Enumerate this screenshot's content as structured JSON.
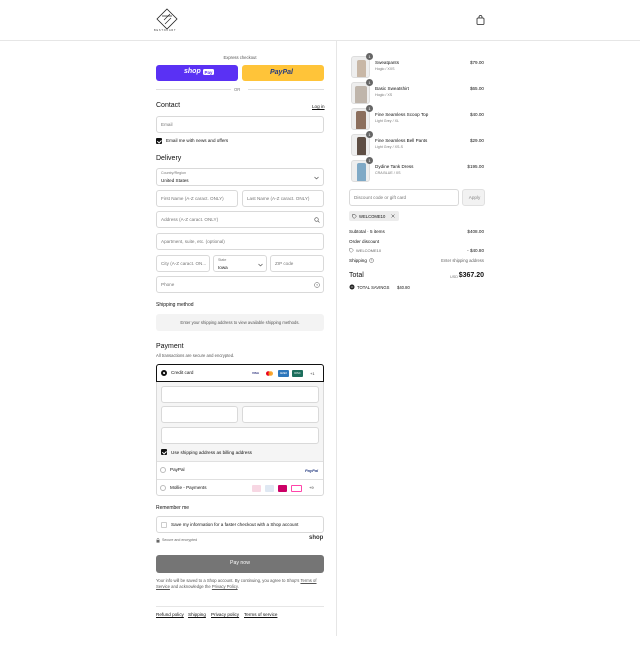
{
  "header": {
    "logo_text": "BESTNCART",
    "cart_icon": "shopping-bag-icon"
  },
  "express": {
    "title": "Express checkout",
    "shop_pay_label": "shop",
    "shop_pay_badge": "Pay",
    "paypal_label": "PayPal",
    "or_text": "OR"
  },
  "contact": {
    "title": "Contact",
    "login_link": "Log in",
    "email_placeholder": "Email",
    "news_label": "Email me with news and offers"
  },
  "delivery": {
    "title": "Delivery",
    "country_label": "Country/Region",
    "country_value": "United States",
    "first_name_placeholder": "First Name (A-Z caract. ONLY)",
    "last_name_placeholder": "Last Name (A-Z caract. ONLY)",
    "address_placeholder": "Address (A-Z caract. ONLY)",
    "apartment_placeholder": "Apartment, suite, etc. (optional)",
    "city_placeholder": "City (A-Z caract. ON...",
    "state_label": "State",
    "state_value": "Iowa",
    "zip_placeholder": "ZIP code",
    "phone_placeholder": "Phone"
  },
  "shipping_method": {
    "title": "Shipping method",
    "notice": "Enter your shipping address to view available shipping methods."
  },
  "payment": {
    "title": "Payment",
    "subtitle": "All transactions are secure and encrypted.",
    "credit_card_label": "Credit card",
    "card_logos": [
      "VISA",
      "MC",
      "AMEX",
      "DISC"
    ],
    "more_cards": "+1",
    "billing_label": "Use shipping address as billing address",
    "paypal_label": "PayPal",
    "paypal_logo": "PayPal",
    "mollie_label": "Mollie - Payments",
    "mollie_more": "+9"
  },
  "remember": {
    "title": "Remember me",
    "save_label": "Save my information for a faster checkout with a Shop account",
    "secure_text": "Secure and encrypted",
    "shop_logo": "shop"
  },
  "pay_button": "Pay now",
  "legal": {
    "line1": "Your info will be saved to a Shop account. By continuing, you agree to Shop's",
    "terms_link": "Terms of Service",
    "mid": " and acknowledge the ",
    "privacy_link": "Privacy Policy",
    "end": "."
  },
  "footer_links": [
    "Refund policy",
    "Shipping",
    "Privacy policy",
    "Terms of service"
  ],
  "cart": {
    "items": [
      {
        "name": "Sweatpants",
        "variant": "Hoglo / XXS",
        "price": "$79.00",
        "qty": "1",
        "color": "#c8b7a6"
      },
      {
        "name": "Basic Sweatshirt",
        "variant": "Hoglo / XS",
        "price": "$65.00",
        "qty": "1",
        "color": "#bfb5ab"
      },
      {
        "name": "Fine Seamless Scoop Top",
        "variant": "Light Grey / XL",
        "price": "$40.00",
        "qty": "1",
        "color": "#8c6f5d"
      },
      {
        "name": "Fine Seamless Bell Pants",
        "variant": "Light Grey / XS-S",
        "price": "$29.00",
        "qty": "1",
        "color": "#5e4e44"
      },
      {
        "name": "Dydine Tank Dress",
        "variant": "CRA BLUE / XS",
        "price": "$195.00",
        "qty": "1",
        "color": "#7fa9c6"
      }
    ],
    "discount_placeholder": "Discount code or gift card",
    "apply_label": "Apply",
    "tag_code": "WELCOME10",
    "subtotal_label": "Subtotal · 5 items",
    "subtotal_value": "$408.00",
    "order_discount_label": "Order discount",
    "discount_code": "WELCOME10",
    "discount_value": "- $40.80",
    "shipping_label": "Shipping",
    "shipping_value": "Enter shipping address",
    "total_label": "Total",
    "currency": "USD",
    "total_value": "$367.20",
    "savings_label": "TOTAL SAVINGS",
    "savings_value": "$40.80"
  }
}
